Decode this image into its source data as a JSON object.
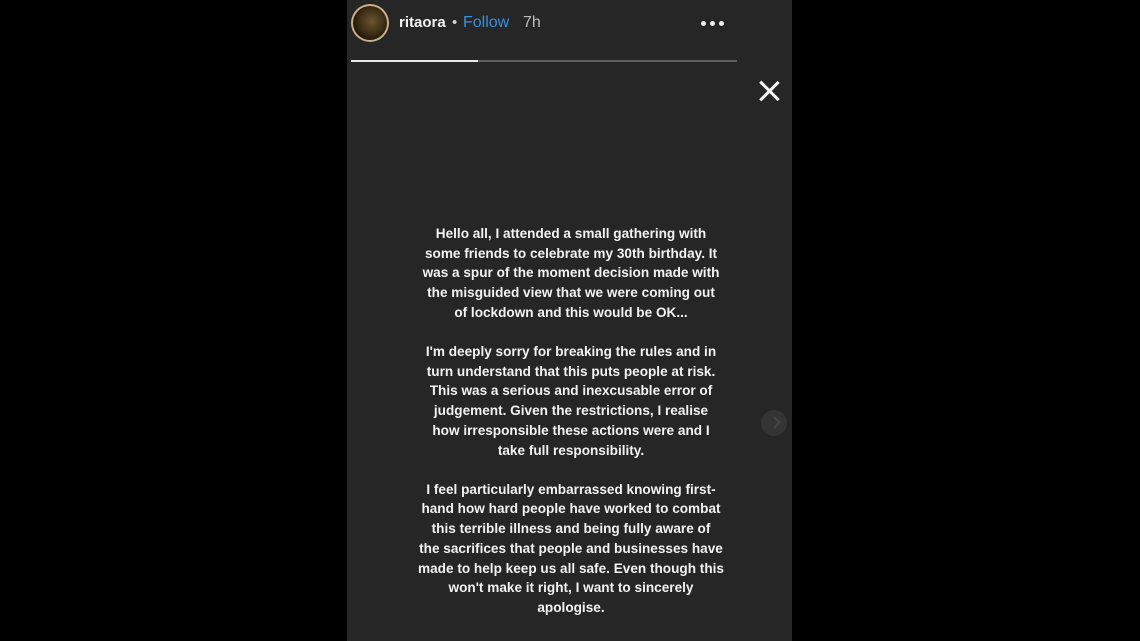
{
  "story": {
    "username": "ritaora",
    "separator": "•",
    "follow_label": "Follow",
    "time": "7h",
    "progress": 0.33,
    "paragraphs": [
      "Hello all, I attended a small gathering with\nsome friends to celebrate my 30th birthday. It\nwas a spur of the moment decision made with\nthe misguided view that we were coming out\nof lockdown and this would be OK...",
      "I'm deeply sorry for breaking the rules and in\nturn understand that this puts people at risk.\nThis was a serious and inexcusable error of\njudgement. Given the restrictions, I realise\nhow irresponsible these actions were and I\ntake full responsibility.",
      "I feel particularly embarrassed knowing first-\nhand how hard people have worked to combat\nthis terrible illness and being fully aware of\nthe sacrifices that people and businesses have\nmade to help keep us all safe. Even though this\nwon't make it right, I want to sincerely\napologise."
    ]
  },
  "icons": {
    "more": "more-options-icon",
    "close": "close-icon",
    "next": "chevron-right-icon"
  },
  "colors": {
    "background": "#000000",
    "story_background": "#262626",
    "follow": "#3a8fe0",
    "text": "#f2f2f2"
  }
}
